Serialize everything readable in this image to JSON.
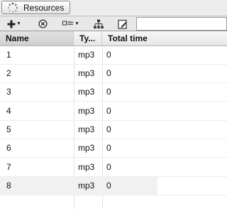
{
  "tab": {
    "label": "Resources",
    "icon": "spinner-icon"
  },
  "toolbar": {
    "items": [
      {
        "name": "add-button",
        "icon": "plus-icon",
        "has_dropdown": true
      },
      {
        "name": "remove-button",
        "icon": "circle-x-icon",
        "has_dropdown": false
      },
      {
        "name": "view-options-button",
        "icon": "list-view-icon",
        "has_dropdown": true
      },
      {
        "name": "hierarchy-button",
        "icon": "hierarchy-icon",
        "has_dropdown": false
      },
      {
        "name": "edit-button",
        "icon": "edit-icon",
        "has_dropdown": false
      }
    ]
  },
  "table": {
    "columns": [
      "Name",
      "Ty...",
      "Total time"
    ],
    "rows": [
      {
        "name": "1",
        "type": "mp3",
        "total_time": "0"
      },
      {
        "name": "2",
        "type": "mp3",
        "total_time": "0"
      },
      {
        "name": "3",
        "type": "mp3",
        "total_time": "0"
      },
      {
        "name": "4",
        "type": "mp3",
        "total_time": "0"
      },
      {
        "name": "5",
        "type": "mp3",
        "total_time": "0"
      },
      {
        "name": "6",
        "type": "mp3",
        "total_time": "0"
      },
      {
        "name": "7",
        "type": "mp3",
        "total_time": "0"
      },
      {
        "name": "8",
        "type": "mp3",
        "total_time": "0"
      }
    ],
    "selected_row": "8"
  }
}
